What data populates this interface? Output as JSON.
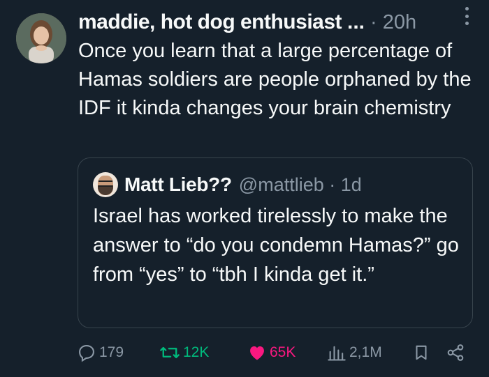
{
  "tweet": {
    "author_name": "maddie, hot dog enthusiast",
    "ellipsis": "...",
    "time": "· 20h",
    "text": "Once you learn that a large percentage of Hamas soldiers are people orphaned by the IDF it kinda changes your brain chemistry"
  },
  "quote": {
    "author_name": "Matt Lieb??",
    "handle": "@mattlieb · 1d",
    "text": "Israel has worked tirelessly to make the answer to “do you condemn Hamas?” go from “yes” to “tbh I kinda get it.”"
  },
  "actions": {
    "replies": "179",
    "reposts": "12K",
    "likes": "65K",
    "views": "2,1M"
  },
  "colors": {
    "background": "#15202b",
    "repost_active": "#00ba7c",
    "like_active": "#f91880",
    "muted": "#8b98a5"
  },
  "icons": [
    "more-icon",
    "reply-icon",
    "repost-icon",
    "heart-icon",
    "views-icon",
    "bookmark-icon",
    "share-icon"
  ]
}
